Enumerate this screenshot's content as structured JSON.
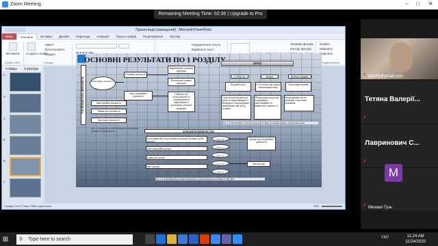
{
  "zoom": {
    "window_title": "Zoom Meeting",
    "banner": "Remaining Meeting Time: 02:36 | Upgrade to Pro",
    "participants": [
      {
        "name": "lybofhj@gmail.com",
        "muted": true
      },
      {
        "name": "Тетяна Валерії...",
        "muted": true
      },
      {
        "name": "Лавринович  С...",
        "muted": true
      },
      {
        "name": "Михаил Гузь",
        "initial": "M",
        "muted": true
      }
    ]
  },
  "ppt": {
    "title": "Презентація (захищений) - Microsoft PowerPoint",
    "tabs": [
      "Файл",
      "Основне",
      "Вставка",
      "Дизайн",
      "Переходи",
      "Анімація",
      "Показ слайдів",
      "Рецензування",
      "Вигляд"
    ],
    "ribbon": {
      "paste": "Вставити",
      "create_slide": "Создать слайд",
      "layout": "Макет",
      "reset": "Восстановить",
      "section": "Раздел",
      "arrange": "Упорядочить",
      "quick_styles": "Экспресс-стили",
      "find": "Знайти",
      "replace": "Замінити",
      "select": "Виділити",
      "shape_fill": "Заливка фигуры",
      "shape_outline": "Контур фигуры",
      "shape_effects": "Эффекты фигуры",
      "text_direction": "Направлення тексту",
      "align_text": "Вирівняти текст",
      "convert_smartart": "Перетворити на SmartArt",
      "groups": [
        "Буфер обмі...",
        "Слайды",
        "Шрифт",
        "Абзац",
        "Рисование",
        "Редактування"
      ]
    },
    "panel_tabs": [
      "Слайды",
      "Структура"
    ],
    "status_left": "Слайд 6 из 15   Тема Office   українська",
    "zoom_level": "75%"
  },
  "slide": {
    "title": "ОСНОВНІ РЕЗУЛЬТАТИ ПО 1 РОЗДІЛУ",
    "vertical_label": "ГОСПОДАРСЬКА ДІЯЛЬНІСТЬ",
    "operating": "Операційна діяльність",
    "main_activity": "Основна діяльність",
    "other_operating": "Інша операційна діяльність",
    "production": "Виробництво основної продукції",
    "sales": "Реалізація основної продукції",
    "ops_services": "Операції, що обслуговують та супроводжують виробництво і реалізацію основної продукції",
    "investment": "Інвестиційна діяльність",
    "financial": "Фінансова діяльність",
    "other_activity": "Інші види діяльності",
    "caption_left": "Рис. 1.1 Склад та основні елементи операційної діяльності підприємства",
    "income_title": "ДОХІД",
    "income_cols": [
      "СУТНІСТЬ",
      "ВИДИ",
      "ФОРМА ВИЯВУ"
    ],
    "income_rows": [
      [
        "Вхідний потік",
        "Стосується зростання економічних вигід",
        "Збільшення активів"
      ],
      [
        "Один з основних показників",
        "Відображає приріст капіталу",
        "Зменшення зобов'язань"
      ]
    ],
    "income_desc": [
      "Сума доходів визнається лише за умови наявності ймовірності надходження економічних вигод від операції",
      "Збільшення доходу від операційної, інвестиційної та фінансової діяльності",
      "Надходження, що не пов'язані з внесками власників"
    ],
    "caption_right": "Рис. 1.2. Економічна сутність доходу, його види та форми прояву для підприємства",
    "income_enterprise_title": "ДОХОДИ ПІДПРИЄМСТВА",
    "income_items": [
      "дохід (виручка) від реалізації продукції (товарів, робіт, послуг)",
      "інші операційні доходи",
      "фінансові доходи",
      "інші доходи"
    ],
    "income_codes": [
      "Код 70",
      "Код 71",
      "Код 72",
      "Код 73",
      "Код 74"
    ],
    "ops_income": "доходи від операційної діяльності",
    "other_income": "інші доходи",
    "caption_bottom": "Рис. 1.4. Класифікація доходів відповідно до бухгалтерського обліку та П(С)БО"
  },
  "taskbar": {
    "search_placeholder": "Type here to search",
    "time": "11:24 AM",
    "date": "11/24/2020",
    "lang": "УКР"
  }
}
